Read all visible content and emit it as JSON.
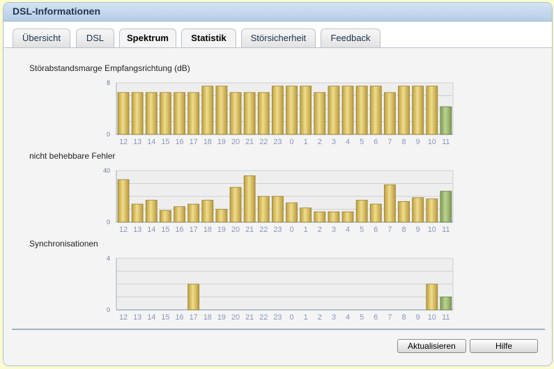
{
  "title": "DSL-Informationen",
  "tabs": [
    {
      "label": "Übersicht",
      "active": false
    },
    {
      "label": "DSL",
      "active": false
    },
    {
      "label": "Spektrum",
      "active": false
    },
    {
      "label": "Statistik",
      "active": true
    },
    {
      "label": "Störsicherheit",
      "active": false
    },
    {
      "label": "Feedback",
      "active": false
    }
  ],
  "colors": {
    "bar": "#d4bb5e",
    "bar_current": "#9ab36e",
    "plot_bg": "#eeeeee",
    "grid": "#d0d0d0",
    "axis": "#9fb0c2",
    "tick_label": "#8a96b8"
  },
  "chart_data": [
    {
      "type": "bar",
      "title": "Störabstandsmarge Empfangsrichtung (dB)",
      "categories": [
        "12",
        "13",
        "14",
        "15",
        "16",
        "17",
        "18",
        "19",
        "20",
        "21",
        "22",
        "23",
        "0",
        "1",
        "2",
        "3",
        "4",
        "5",
        "6",
        "7",
        "8",
        "9",
        "10",
        "11"
      ],
      "values": [
        6.5,
        6.5,
        6.5,
        6.5,
        6.5,
        6.5,
        7.5,
        7.5,
        6.5,
        6.5,
        6.5,
        7.5,
        7.5,
        7.5,
        6.5,
        7.5,
        7.5,
        7.5,
        7.5,
        6.5,
        7.5,
        7.5,
        7.5,
        4.3
      ],
      "ylim": [
        0,
        8
      ],
      "yticks": [
        "8",
        "0"
      ],
      "highlight_last": true
    },
    {
      "type": "bar",
      "title": "nicht behebbare Fehler",
      "categories": [
        "12",
        "13",
        "14",
        "15",
        "16",
        "17",
        "18",
        "19",
        "20",
        "21",
        "22",
        "23",
        "0",
        "1",
        "2",
        "3",
        "4",
        "5",
        "6",
        "7",
        "8",
        "9",
        "10",
        "11"
      ],
      "values": [
        33,
        14,
        17,
        9,
        12,
        14,
        17,
        10,
        27,
        36,
        20,
        20,
        15,
        11,
        8,
        8,
        8,
        17,
        14,
        29,
        16,
        19,
        18,
        24
      ],
      "ylim": [
        0,
        40
      ],
      "yticks": [
        "40",
        "0"
      ],
      "highlight_last": true
    },
    {
      "type": "bar",
      "title": "Synchronisationen",
      "categories": [
        "12",
        "13",
        "14",
        "15",
        "16",
        "17",
        "18",
        "19",
        "20",
        "21",
        "22",
        "23",
        "0",
        "1",
        "2",
        "3",
        "4",
        "5",
        "6",
        "7",
        "8",
        "9",
        "10",
        "11"
      ],
      "values": [
        0,
        0,
        0,
        0,
        0,
        2,
        0,
        0,
        0,
        0,
        0,
        0,
        0,
        0,
        0,
        0,
        0,
        0,
        0,
        0,
        0,
        0,
        2,
        1
      ],
      "ylim": [
        0,
        4
      ],
      "yticks": [
        "4",
        "0"
      ],
      "highlight_last": true
    }
  ],
  "buttons": {
    "refresh": "Aktualisieren",
    "help": "Hilfe"
  }
}
